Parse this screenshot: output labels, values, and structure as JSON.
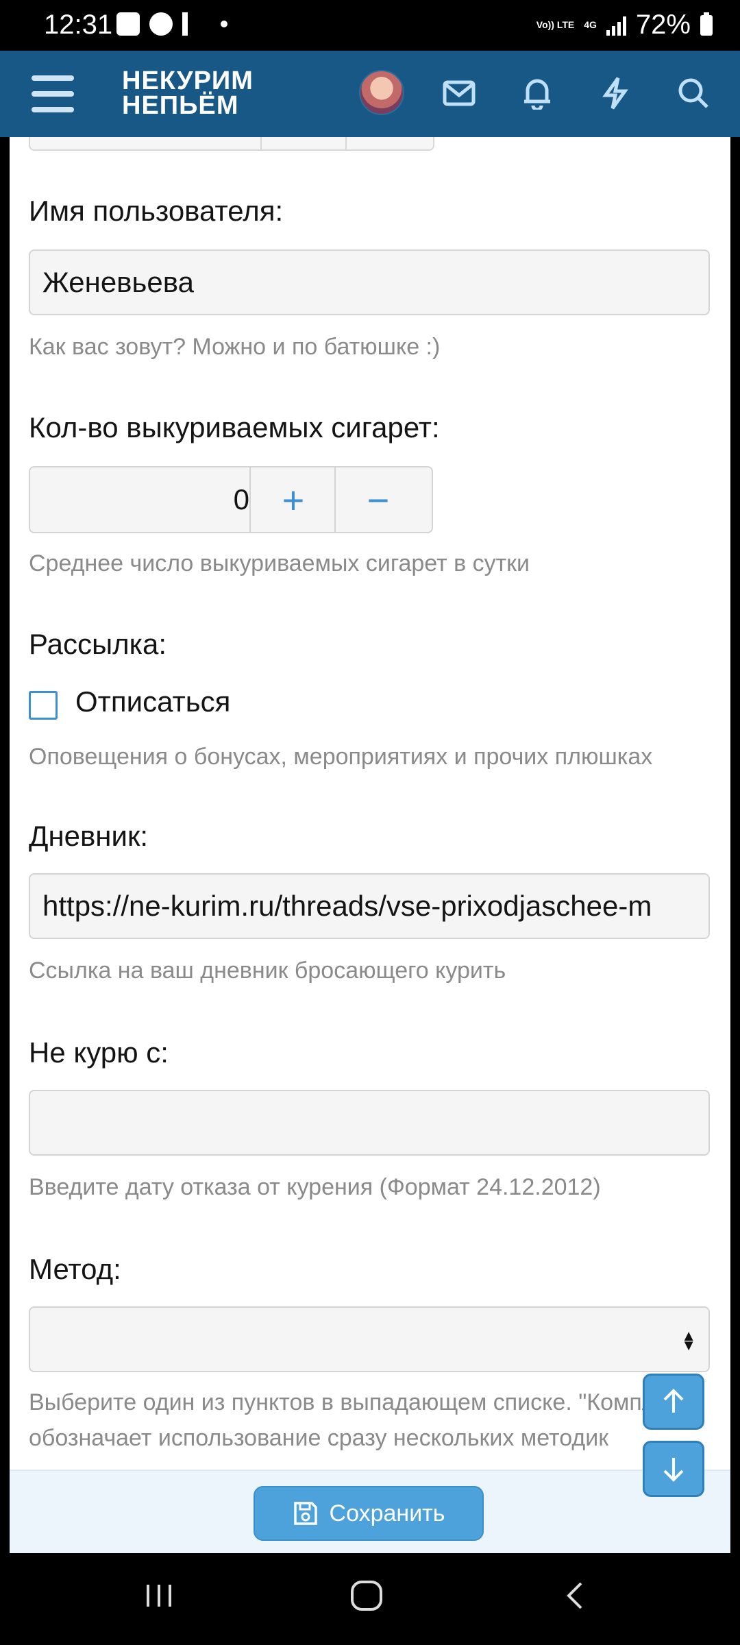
{
  "status_bar": {
    "time": "12:31",
    "network_top": "Vo)) LTE",
    "network_type": "4G",
    "battery": "72%"
  },
  "header": {
    "logo_line1": "НЕКУРИМ",
    "logo_line2": "НЕПЬЁМ",
    "icons": [
      "menu-icon",
      "avatar",
      "mail-icon",
      "bell-icon",
      "lightning-icon",
      "search-icon"
    ]
  },
  "form": {
    "username": {
      "label": "Имя пользователя:",
      "value": "Женевьева",
      "hint": "Как вас зовут? Можно и по батюшке :)"
    },
    "cigarettes": {
      "label": "Кол-во выкуриваемых сигарет:",
      "value": "0",
      "plus": "+",
      "minus": "−",
      "hint": "Среднее число выкуриваемых сигарет в сутки"
    },
    "mailing": {
      "label": "Рассылка:",
      "checkbox_label": "Отписаться",
      "checked": false,
      "hint": "Оповещения о бонусах, мероприятиях и прочих плюшках"
    },
    "diary": {
      "label": "Дневник:",
      "value": "https://ne-kurim.ru/threads/vse-prixodjaschee-m",
      "hint": "Ссылка на ваш дневник бросающего курить"
    },
    "quit_date": {
      "label": "Не курю с:",
      "value": "",
      "hint": "Введите дату отказа от курения (Формат 24.12.2012)"
    },
    "method": {
      "label": "Метод:",
      "value": "",
      "hint": "Выберите один из пунктов в выпадающем списке. \"Комплекс\" обозначает использование сразу нескольких методик"
    }
  },
  "actions": {
    "save_label": "Сохранить"
  }
}
